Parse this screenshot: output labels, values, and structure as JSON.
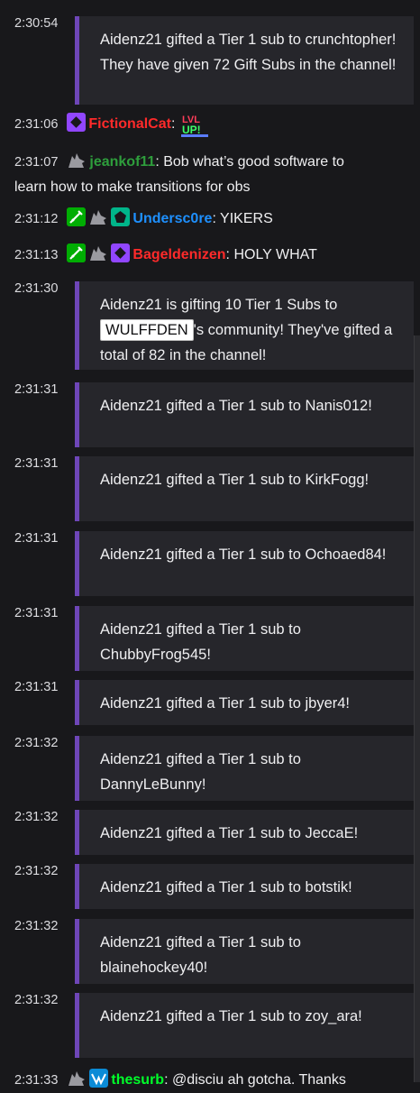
{
  "top_partial": "",
  "messages": {
    "n1": {
      "time": "2:30:54",
      "text": "Aidenz21 gifted a Tier 1 sub to crunchtopher! They have given 72 Gift Subs in the channel!"
    },
    "c1": {
      "time": "2:31:06",
      "user": "FictionalCat",
      "sep": ":",
      "emote": "LVL UP!"
    },
    "c2": {
      "time": "2:31:07",
      "user": "jeankof11",
      "sep": ":",
      "text": "Bob what’s good software to learn how to make transitions for obs"
    },
    "c3": {
      "time": "2:31:12",
      "user": "Undersc0re",
      "sep": ":",
      "text": "YIKERS"
    },
    "c4": {
      "time": "2:31:13",
      "user": "Bageldenizen",
      "sep": ":",
      "text": "HOLY WHAT"
    },
    "n2": {
      "time": "2:31:30",
      "pre": "Aidenz21 is gifting 10 Tier 1 Subs to",
      "chip": "WULFFDEN",
      "post": "'s community! They've gifted a total of 82 in the channel!"
    },
    "n3": {
      "time": "2:31:31",
      "text": "Aidenz21 gifted a Tier 1 sub to Nanis012!"
    },
    "n4": {
      "time": "2:31:31",
      "text": "Aidenz21 gifted a Tier 1 sub to KirkFogg!"
    },
    "n5": {
      "time": "2:31:31",
      "text": "Aidenz21 gifted a Tier 1 sub to Ochoaed84!"
    },
    "n6": {
      "time": "2:31:31",
      "text": "Aidenz21 gifted a Tier 1 sub to ChubbyFrog545!"
    },
    "n7": {
      "time": "2:31:31",
      "text": "Aidenz21 gifted a Tier 1 sub to jbyer4!"
    },
    "n8": {
      "time": "2:31:32",
      "text": "Aidenz21 gifted a Tier 1 sub to DannyLeBunny!"
    },
    "n9": {
      "time": "2:31:32",
      "text": "Aidenz21 gifted a Tier 1 sub to JeccaE!"
    },
    "n10": {
      "time": "2:31:32",
      "text": "Aidenz21 gifted a Tier 1 sub to botstik!"
    },
    "n11": {
      "time": "2:31:32",
      "text": "Aidenz21 gifted a Tier 1 sub to blainehockey40!"
    },
    "n12": {
      "time": "2:31:32",
      "text": "Aidenz21 gifted a Tier 1 sub to zoy_ara!"
    },
    "c5": {
      "time": "2:31:33",
      "user": "thesurb",
      "sep": ":",
      "text": "@disciu ah gotcha. Thanks"
    }
  },
  "icons": [
    "wolf-icon",
    "sword-icon",
    "pentagon-icon",
    "diamond-icon",
    "wing-icon"
  ],
  "colors": {
    "notice_border": "#6e46b8",
    "background": "#18181b",
    "notice_bg": "#26262b"
  }
}
